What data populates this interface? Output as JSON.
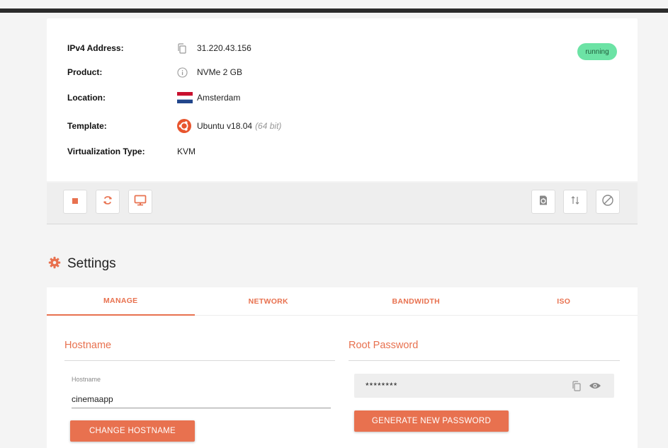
{
  "server": {
    "status": "running",
    "colors": {
      "status_bg": "#6ce3a5",
      "accent": "#e8714f"
    },
    "details": [
      {
        "label": "IPv4 Address:",
        "icon": "copy-icon",
        "value": "31.220.43.156"
      },
      {
        "label": "Product:",
        "icon": "info-icon",
        "value": "NVMe 2 GB"
      },
      {
        "label": "Location:",
        "icon": "netherlands-flag-icon",
        "value": "Amsterdam"
      },
      {
        "label": "Template:",
        "icon": "ubuntu-logo-icon",
        "value": "Ubuntu v18.04",
        "value_note": "(64 bit)"
      },
      {
        "label": "Virtualization Type:",
        "icon": "",
        "value": "KVM"
      }
    ]
  },
  "actions": {
    "left": [
      "stop-icon",
      "restart-icon",
      "console-icon"
    ],
    "right": [
      "backup-icon",
      "transfer-icon",
      "disable-icon"
    ]
  },
  "settings": {
    "title": "Settings",
    "tabs": [
      {
        "label": "MANAGE",
        "active": true
      },
      {
        "label": "NETWORK",
        "active": false
      },
      {
        "label": "BANDWIDTH",
        "active": false
      },
      {
        "label": "ISO",
        "active": false
      }
    ],
    "hostname": {
      "section_title": "Hostname",
      "field_label": "Hostname",
      "value": "cinemaapp",
      "button": "CHANGE HOSTNAME"
    },
    "root_password": {
      "section_title": "Root Password",
      "masked_value": "********",
      "button": "GENERATE NEW PASSWORD"
    }
  }
}
